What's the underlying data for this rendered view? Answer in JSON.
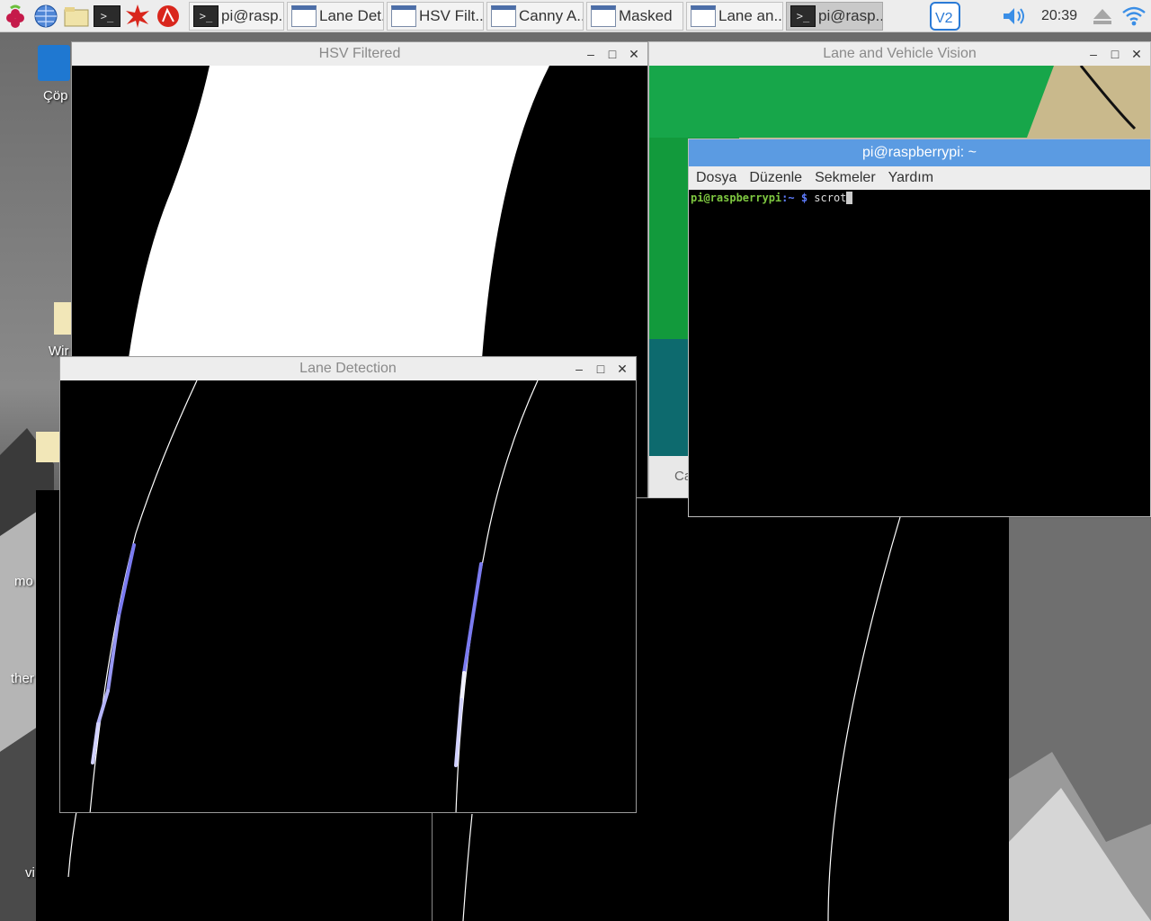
{
  "taskbar": {
    "launchers": [
      "raspberry-menu-icon",
      "web-browser-icon",
      "file-manager-icon",
      "terminal-icon",
      "mathematica-icon",
      "wolfram-icon"
    ],
    "tasks": [
      {
        "label": "pi@rasp...",
        "icon": "terminal",
        "active": false
      },
      {
        "label": "Lane Det...",
        "icon": "window",
        "active": false
      },
      {
        "label": "HSV Filt...",
        "icon": "window",
        "active": false
      },
      {
        "label": "Canny A...",
        "icon": "window",
        "active": false
      },
      {
        "label": "Masked",
        "icon": "window",
        "active": false
      },
      {
        "label": "Lane an...",
        "icon": "window",
        "active": false
      },
      {
        "label": "pi@rasp...",
        "icon": "terminal",
        "active": true
      }
    ],
    "clock": "20:39"
  },
  "desktop": {
    "icons": [
      "Çöp",
      "Wir",
      "mo",
      "ther",
      "vi"
    ]
  },
  "windows": {
    "hsv": {
      "title": "HSV Filtered"
    },
    "lane_vehicle": {
      "title": "Lane and Vehicle Vision",
      "partial_label": "Ca"
    },
    "lane_detection": {
      "title": "Lane Detection"
    },
    "terminal": {
      "title": "pi@raspberrypi: ~",
      "menu": [
        "Dosya",
        "Düzenle",
        "Sekmeler",
        "Yardım"
      ],
      "prompt_user": "pi@raspberrypi",
      "prompt_path": ":~ $",
      "command": " scrot"
    }
  },
  "colors": {
    "titlebar_active": "#5b9be2",
    "lane_line_blue": "#7b7bf0",
    "lane_line_light": "#c8c8ff"
  }
}
